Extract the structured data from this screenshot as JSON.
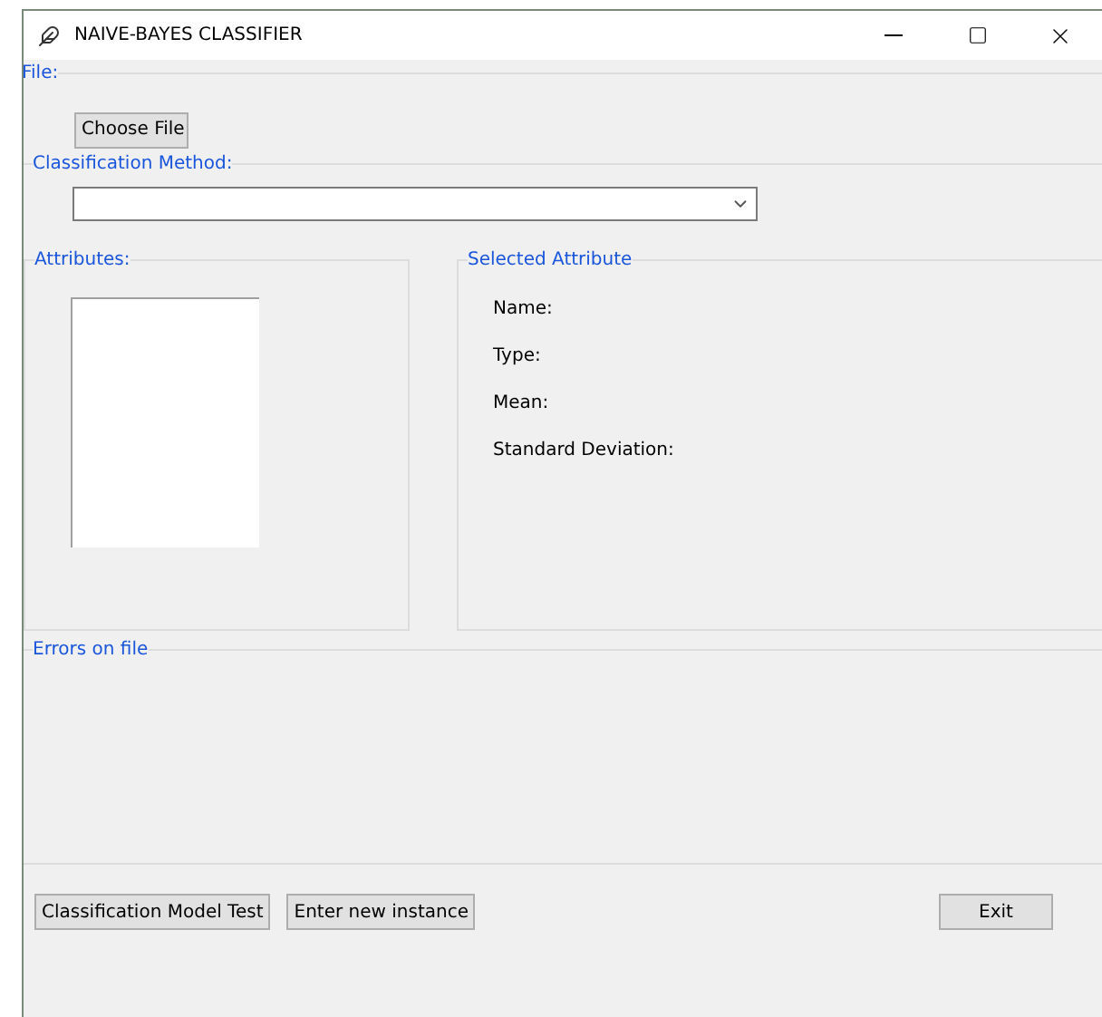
{
  "window": {
    "title": "NAIVE-BAYES CLASSIFIER"
  },
  "file_section": {
    "label": "File:",
    "button": "Choose File"
  },
  "method_section": {
    "label": "Classification Method:"
  },
  "attributes_section": {
    "label": "Attributes:"
  },
  "selected_attribute": {
    "label": "Selected Attribute",
    "fields": [
      "Name:",
      "Type:",
      "Mean:",
      "Standard Deviation:"
    ]
  },
  "errors_section": {
    "label": "Errors on file"
  },
  "buttons": [
    {
      "label": "Classification Model Test"
    },
    {
      "label": "Enter new instance"
    }
  ],
  "exit_button": {
    "label": "Exit"
  }
}
